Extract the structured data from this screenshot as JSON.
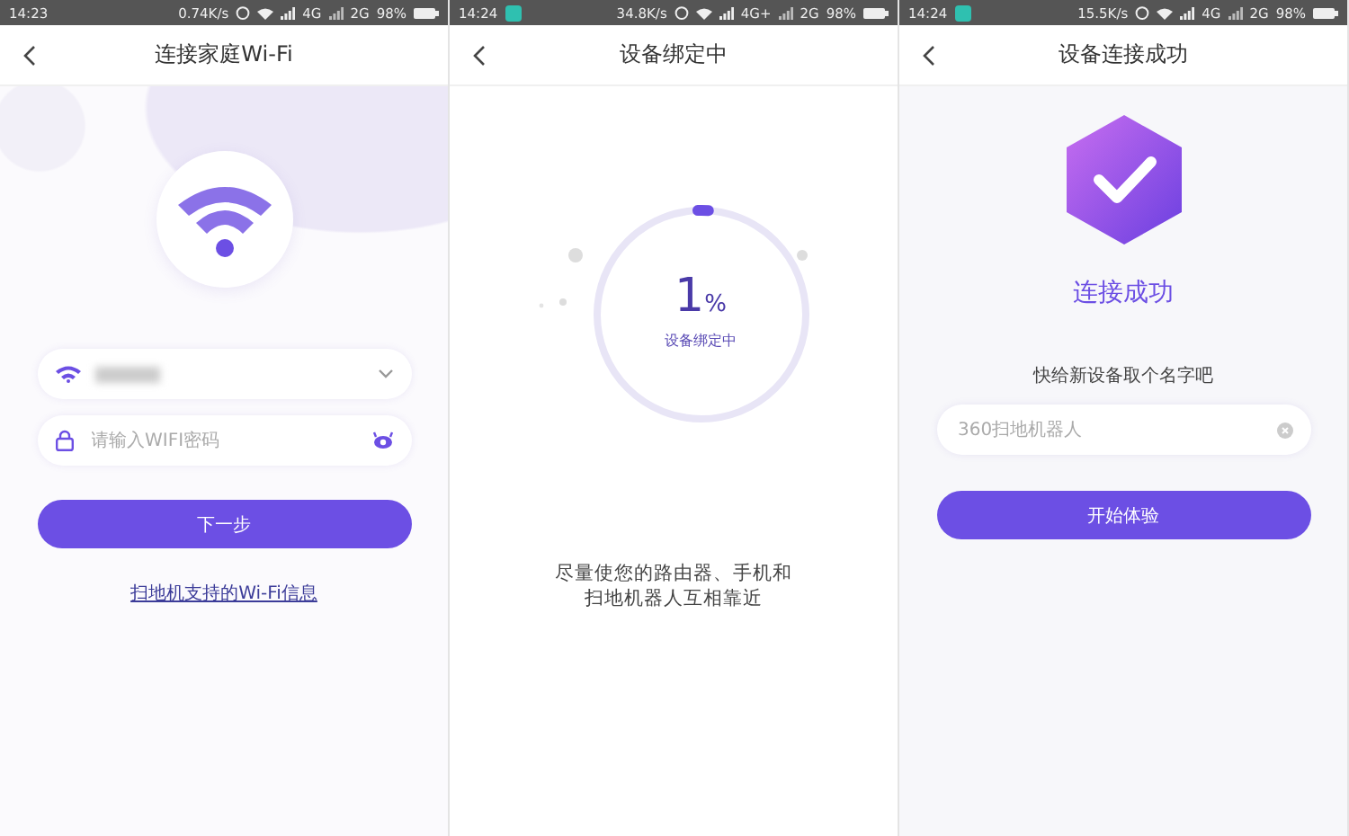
{
  "screens": [
    {
      "kind": "wifi",
      "status_bar": {
        "time": "14:23",
        "speed": "0.74K/s",
        "network_1": "4G",
        "network_2": "2G",
        "battery": "98%",
        "notification": false
      },
      "title": "连接家庭Wi-Fi",
      "password_field": {
        "placeholder": "请输入WIFI密码"
      },
      "next_button": "下一步",
      "info_link": "扫地机支持的Wi-Fi信息"
    },
    {
      "kind": "binding",
      "status_bar": {
        "time": "14:24",
        "speed": "34.8K/s",
        "network_1": "4G+",
        "network_2": "2G",
        "battery": "98%",
        "notification": true
      },
      "title": "设备绑定中",
      "progress": {
        "number": "1",
        "unit": "%",
        "label": "设备绑定中",
        "level": 0.01
      },
      "hint_lines": [
        "尽量使您的路由器、手机和",
        "扫地机器人互相靠近"
      ]
    },
    {
      "kind": "success",
      "status_bar": {
        "time": "14:24",
        "speed": "15.5K/s",
        "network_1": "4G",
        "network_2": "2G",
        "battery": "98%",
        "notification": true
      },
      "title": "设备连接成功",
      "success_text": "连接成功",
      "name_prompt": "快给新设备取个名字吧",
      "name_field": {
        "value": "360扫地机器人"
      },
      "start_button": "开始体验"
    }
  ]
}
